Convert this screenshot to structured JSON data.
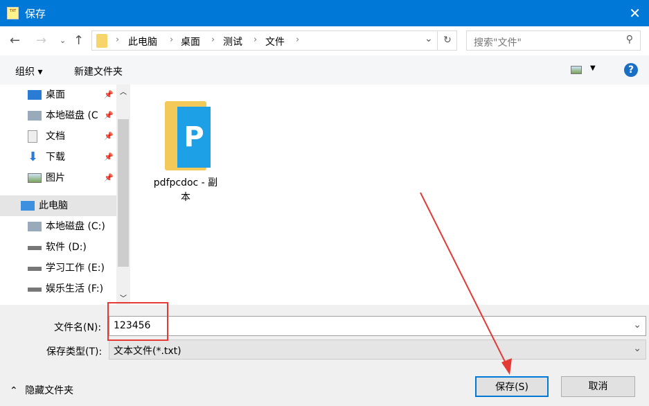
{
  "window": {
    "title": "保存",
    "app_icon_text": "TXT"
  },
  "address": {
    "crumbs": [
      "此电脑",
      "桌面",
      "测试",
      "文件"
    ],
    "search_placeholder": "搜索\"文件\""
  },
  "toolbar": {
    "organize": "组织 ▾",
    "new_folder": "新建文件夹"
  },
  "nav": [
    {
      "label": "桌面",
      "pinned": true
    },
    {
      "label": "本地磁盘 (C",
      "pinned": true
    },
    {
      "label": "文档",
      "pinned": true
    },
    {
      "label": "下载",
      "pinned": true
    },
    {
      "label": "图片",
      "pinned": true
    },
    {
      "label": "此电脑",
      "pinned": false
    },
    {
      "label": "本地磁盘 (C:)",
      "pinned": false
    },
    {
      "label": "软件 (D:)",
      "pinned": false
    },
    {
      "label": "学习工作 (E:)",
      "pinned": false
    },
    {
      "label": "娱乐生活 (F:)",
      "pinned": false
    }
  ],
  "files": [
    {
      "name": "pdfpcdoc - 副本"
    }
  ],
  "form": {
    "filename_label": "文件名(N):",
    "filename_value": "123456",
    "type_label": "保存类型(T):",
    "type_value": "文本文件(*.txt)"
  },
  "footer": {
    "hide_folders": "隐藏文件夹",
    "save": "保存(S)",
    "cancel": "取消"
  }
}
